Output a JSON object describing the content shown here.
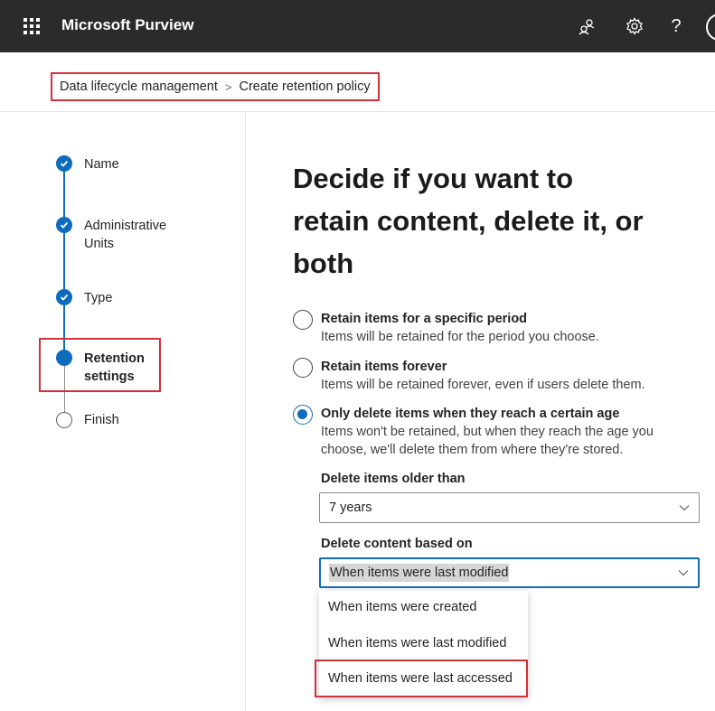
{
  "topbar": {
    "app_title": "Microsoft Purview",
    "icons": [
      "waffle-icon",
      "people-icon",
      "gear-icon",
      "help-icon",
      "avatar"
    ],
    "help_glyph": "?"
  },
  "breadcrumb": {
    "items": [
      "Data lifecycle management",
      "Create retention policy"
    ],
    "separator": ">"
  },
  "wizard": {
    "steps": [
      {
        "label": "Name",
        "state": "completed"
      },
      {
        "label": "Administrative Units",
        "state": "completed"
      },
      {
        "label": "Type",
        "state": "completed"
      },
      {
        "label": "Retention settings",
        "state": "current"
      },
      {
        "label": "Finish",
        "state": "pending"
      }
    ],
    "step_labels": {
      "name": "Name",
      "admin_line1": "Administrative",
      "admin_line2": "Units",
      "type": "Type",
      "retention_line1": "Retention",
      "retention_line2": "settings",
      "finish": "Finish"
    }
  },
  "main": {
    "heading_lines": [
      "Decide if you want to",
      "retain content, delete it, or",
      "both"
    ],
    "options": [
      {
        "title": "Retain items for a specific period",
        "description": "Items will be retained for the period you choose.",
        "selected": false
      },
      {
        "title": "Retain items forever",
        "description": "Items will be retained forever, even if users delete them.",
        "selected": false
      },
      {
        "title": "Only delete items when they reach a certain age",
        "description_lines": [
          "Items won't be retained, but when they reach the age you",
          "choose, we'll delete them from where they're stored."
        ],
        "selected": true
      }
    ],
    "delete_older_than": {
      "label": "Delete items older than",
      "value": "7 years"
    },
    "delete_based_on": {
      "label": "Delete content based on",
      "value": "When items were last modified",
      "options": [
        "When items were created",
        "When items were last modified",
        "When items were last accessed"
      ]
    }
  },
  "colors": {
    "topbar": "#2b2b2b",
    "accent": "#0f6cbd",
    "highlight_box": "#d0313b"
  }
}
